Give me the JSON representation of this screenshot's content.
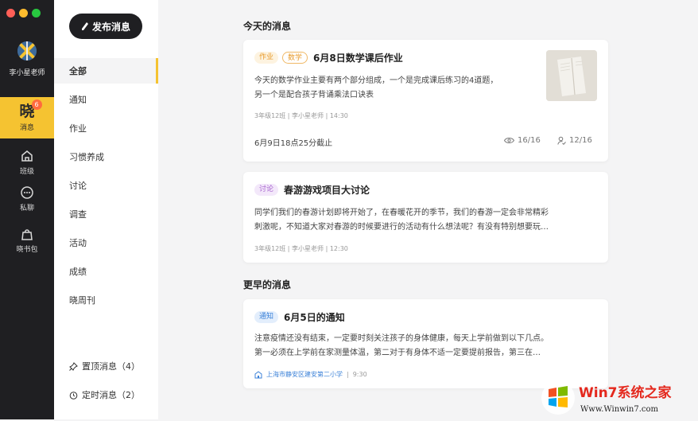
{
  "window": {
    "dot_colors": [
      "#ff5f57",
      "#febc2e",
      "#28c840"
    ]
  },
  "user": {
    "name": "李小星老师"
  },
  "rail": {
    "items": [
      {
        "label": "消息",
        "glyph": "晓",
        "badge": "6",
        "icon": "message-icon",
        "active": true
      },
      {
        "label": "班级",
        "icon": "home-icon"
      },
      {
        "label": "私聊",
        "icon": "chat-icon"
      },
      {
        "label": "晓书包",
        "icon": "bag-icon"
      }
    ]
  },
  "categories": {
    "publish_label": "发布消息",
    "items": [
      "全部",
      "通知",
      "作业",
      "习惯养成",
      "讨论",
      "调查",
      "活动",
      "成绩",
      "晓周刊"
    ],
    "pinned": "置顶消息（4）",
    "scheduled": "定时消息（2）"
  },
  "main": {
    "today_title": "今天的消息",
    "earlier_title": "更早的消息",
    "cards": [
      {
        "tags": [
          "作业",
          "数学"
        ],
        "title": "6月8日数学课后作业",
        "body_line1": "今天的数学作业主要有两个部分组成，一个是完成课后练习的4道题，",
        "body_line2": "另一个是配合孩子背诵乘法口诀表",
        "meta": "3年级12班 | 李小星老师 | 14:30",
        "deadline": "6月9日18点25分截止",
        "views": "16/16",
        "done": "12/16"
      },
      {
        "tags": [
          "讨论"
        ],
        "title": "春游游戏项目大讨论",
        "body_line1": "同学们我们的春游计划即将开始了，在春暖花开的季节，我们的春游一定会非常精彩",
        "body_line2": "刺激呢，不知道大家对春游的时候要进行的活动有什么想法呢？有没有特别想要玩…",
        "meta": "3年级12班 | 李小星老师 | 12:30"
      },
      {
        "tags": [
          "通知"
        ],
        "title": "6月5日的通知",
        "body_line1": "注意疫情还没有结束，一定要时刻关注孩子的身体健康，每天上学前做到以下几点。",
        "body_line2": "第一必须在上学前在家测量体温，第二对于有身体不适一定要提前报告，第三在…",
        "school": "上海市静安区建安第二小学",
        "time": "9:30"
      }
    ]
  },
  "watermark": {
    "brand": "Win7系统之家",
    "url": "Www.Winwin7.com"
  }
}
